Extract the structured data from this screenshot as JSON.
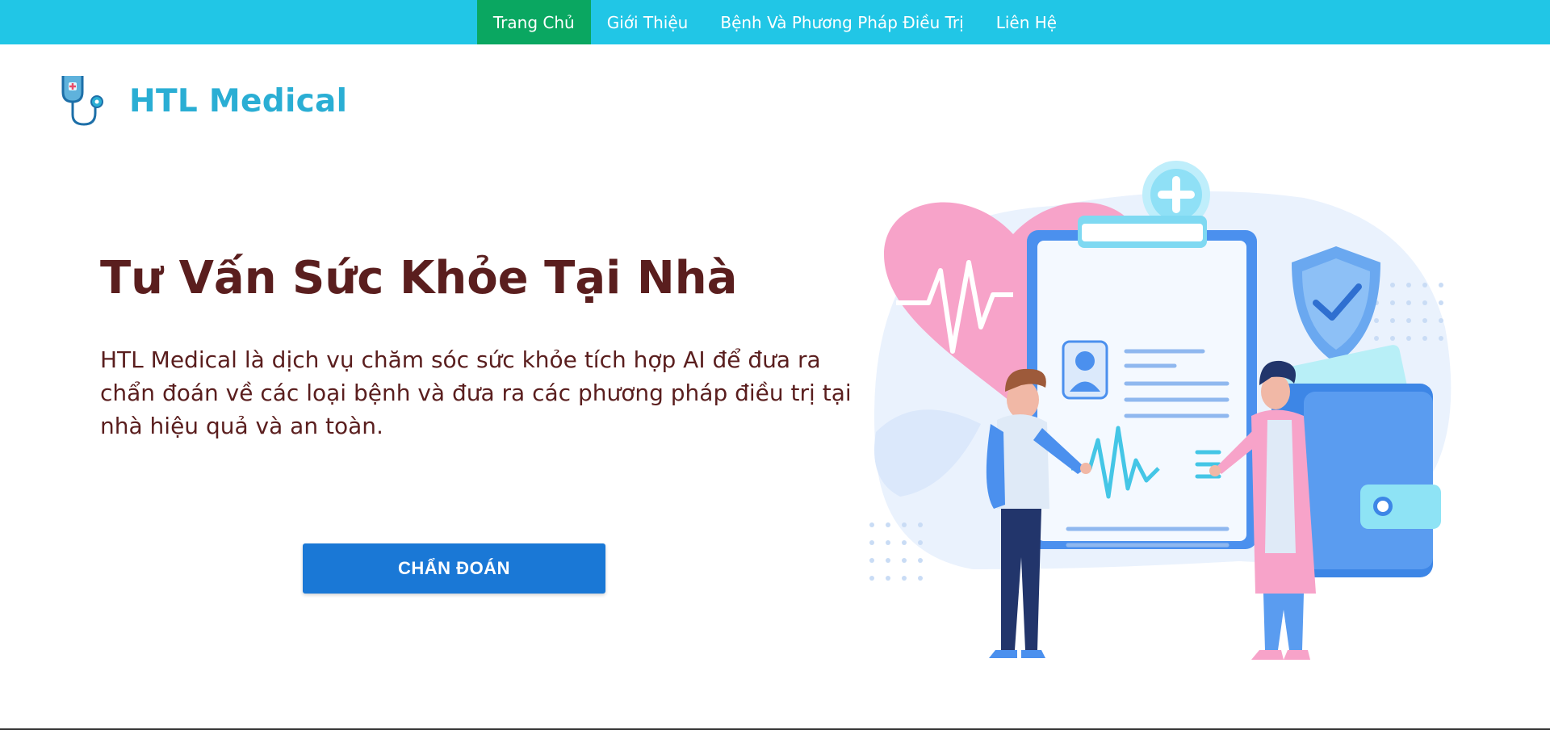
{
  "nav": {
    "items": [
      {
        "label": "Trang Chủ",
        "active": true
      },
      {
        "label": "Giới Thiệu",
        "active": false
      },
      {
        "label": "Bệnh Và Phương Pháp Điều Trị",
        "active": false
      },
      {
        "label": "Liên Hệ",
        "active": false
      }
    ],
    "bar_color": "#21c6e6",
    "active_color": "#0aa761"
  },
  "brand": {
    "name": "HTL Medical",
    "logo_icon": "stethoscope-icon",
    "color": "#2aaed4"
  },
  "hero": {
    "title": "Tư Vấn Sức Khỏe Tại Nhà",
    "description": "HTL Medical là dịch vụ chăm sóc sức khỏe tích hợp AI để đưa ra chẩn đoán về các loại bệnh và đưa ra các phương pháp điều trị tại nhà hiệu quả và an toàn.",
    "cta_label": "CHẨN ĐOÁN",
    "text_color": "#5a1e1e",
    "cta_color": "#1a78d6"
  },
  "illustration": {
    "icon": "medical-consultation-illustration"
  }
}
